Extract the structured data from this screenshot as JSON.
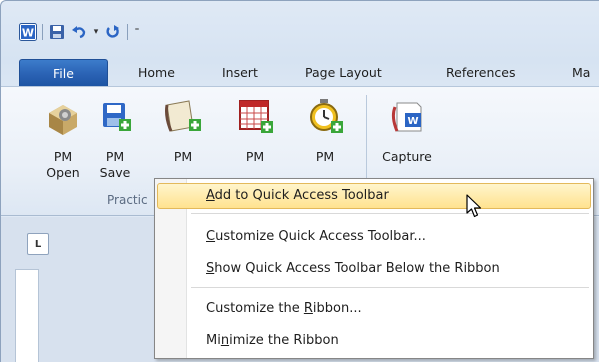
{
  "qat": {
    "word_icon": "word-app-icon",
    "save_icon": "save-icon",
    "undo_icon": "undo-icon",
    "dropdown_glyph": "▾",
    "redo_icon": "repeat-icon",
    "customize_glyph": "⁼"
  },
  "tabs": {
    "file": "File",
    "home": "Home",
    "insert": "Insert",
    "page_layout": "Page Layout",
    "references": "References",
    "mailings_partial": "Ma"
  },
  "ribbon": {
    "buttons": [
      {
        "label1": "PM",
        "label2": "Open",
        "icon": "pm-open-icon"
      },
      {
        "label1": "PM",
        "label2": "Save",
        "icon": "pm-save-icon"
      },
      {
        "label1": "PM",
        "label2": "",
        "icon": "pm-notes-icon"
      },
      {
        "label1": "PM",
        "label2": "",
        "icon": "pm-calendar-icon"
      },
      {
        "label1": "PM",
        "label2": "",
        "icon": "pm-timer-icon"
      },
      {
        "label1": "Capture",
        "label2": "",
        "icon": "capture-icon"
      }
    ],
    "group_label": "Practic"
  },
  "context_menu": {
    "items": [
      {
        "prefix": "",
        "mnemonic": "A",
        "suffix": "dd to Quick Access Toolbar"
      },
      {
        "prefix": "",
        "mnemonic": "C",
        "suffix": "ustomize Quick Access Toolbar..."
      },
      {
        "prefix": "",
        "mnemonic": "S",
        "suffix": "how Quick Access Toolbar Below the Ribbon"
      },
      {
        "prefix": "Customize the ",
        "mnemonic": "R",
        "suffix": "ibbon..."
      },
      {
        "prefix": "Mi",
        "mnemonic": "n",
        "suffix": "imize the Ribbon"
      }
    ]
  },
  "ruler_tab_glyph": "L",
  "colors": {
    "file_tab": "#2a62b4",
    "menu_hover": "#ffe28f",
    "ribbon_bg": "#eaf0f8"
  }
}
